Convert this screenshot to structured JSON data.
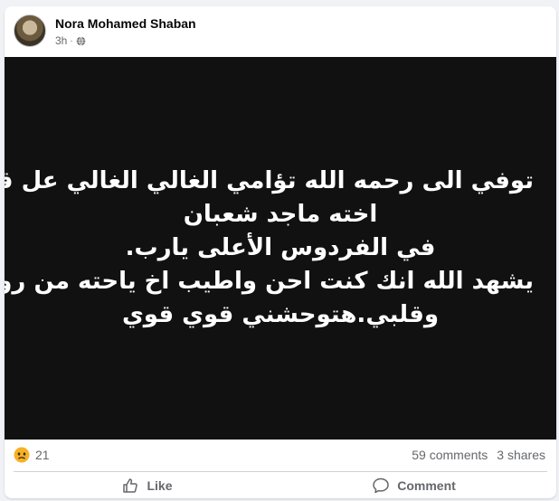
{
  "post": {
    "author": "Nora Mohamed Shaban",
    "time": "3h",
    "meta_separator": "·",
    "privacy_icon": "globe-icon",
    "image_text_lines": [
      "توفي الى رحمه الله تؤامي الغالي الغالي عل قلب",
      "اخته ماجد شعبان",
      "في الفردوس الأعلى يارب.",
      "يشهد الله انك كنت احن واطيب اخ ياحته من روحي",
      "وقلبي.هتوحشني قوي قوي"
    ],
    "image_background": "#111111",
    "image_text_color": "#ffffff"
  },
  "stats": {
    "reaction_icon": "sad-face-icon",
    "reaction_count": "21",
    "comments": "59 comments",
    "shares": "3 shares"
  },
  "actions": {
    "like_label": "Like",
    "like_icon": "thumbs-up-icon",
    "comment_label": "Comment",
    "comment_icon": "speech-bubble-icon"
  },
  "colors": {
    "secondary_text": "#65676b",
    "reaction_yellow": "#f7b125"
  }
}
